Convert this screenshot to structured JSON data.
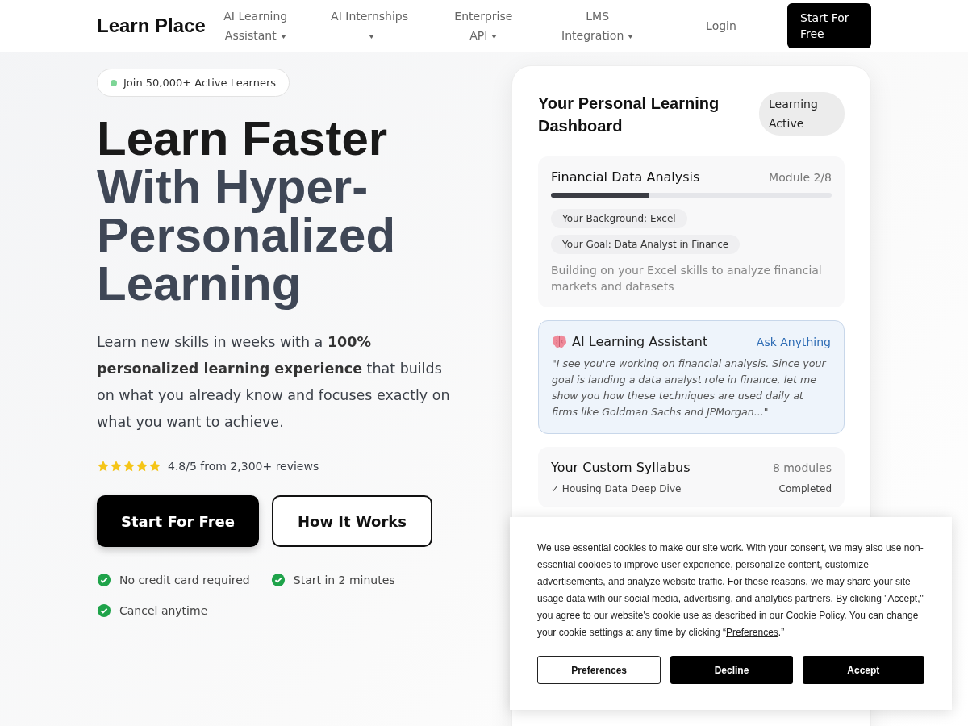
{
  "header": {
    "logo": "Learn Place",
    "nav": [
      {
        "label": "AI Learning Assistant",
        "dropdown": true
      },
      {
        "label": "AI Internships",
        "dropdown": true
      },
      {
        "label": "Enterprise API",
        "dropdown": true
      },
      {
        "label": "LMS Integration",
        "dropdown": true
      },
      {
        "label": "Login",
        "dropdown": false
      }
    ],
    "cta": "Start For Free"
  },
  "hero": {
    "badge": "Join 50,000+ Active Learners",
    "title_dark": "Learn Faster",
    "title_muted": "With Hyper-Personalized Learning",
    "lead": "Learn new skills in weeks with a **100% personalized learning experience** that builds on what you already know and focuses exactly on what you want to achieve.",
    "rating": {
      "stars": 5,
      "text": "4.8/5 from 2,300+ reviews"
    },
    "buttons": [
      {
        "label": "Start For Free",
        "kind": "primary"
      },
      {
        "label": "How It Works",
        "kind": "outline"
      }
    ],
    "perks": [
      "No credit card required",
      "Start in 2 minutes",
      "Cancel anytime"
    ]
  },
  "dashboard": {
    "title": "Your Personal Learning Dashboard",
    "status": "Learning Active",
    "module": {
      "name": "Financial Data Analysis",
      "step": "Module 2/8",
      "level": 0.35,
      "tags": [
        "Your Background: Excel",
        "Your Goal: Data Analyst in Finance"
      ],
      "note": "Building on your Excel skills to analyze financial markets and datasets"
    },
    "assistant": {
      "title": "AI Learning Assistant",
      "action": "Ask Anything",
      "quote": "\"I see you're working on financial analysis. Since your goal is landing a data analyst role in finance, let me show you how these techniques are used daily at firms like Goldman Sachs and JPMorgan...\""
    },
    "syllabus": {
      "title": "Your Custom Syllabus",
      "count": "8 modules",
      "rows": [
        {
          "name": "✓ Housing Data Deep Dive",
          "status": "Completed"
        }
      ]
    }
  },
  "cookie_banner": {
    "text": [
      {
        "kind": "text",
        "text": "We use essential cookies to make our site work. With your consent, we may also use non-essential cookies to improve user experience, personalize content, customize advertisements, and analyze website traffic. For these reasons, we may share your site usage data with our social media, advertising, and analytics partners. By clicking \"Accept,\" you agree to our website's cookie use as described in our "
      },
      {
        "kind": "link",
        "text": "Cookie Policy"
      },
      {
        "kind": "text",
        "text": ". You can change your cookie settings at any time by clicking “"
      },
      {
        "kind": "link",
        "text": "Preferences"
      },
      {
        "kind": "text",
        "text": ".”"
      }
    ],
    "buttons": [
      {
        "label": "Preferences",
        "kind": "outline"
      },
      {
        "label": "Decline",
        "kind": "primary"
      },
      {
        "label": "Accept",
        "kind": "primary"
      }
    ]
  }
}
